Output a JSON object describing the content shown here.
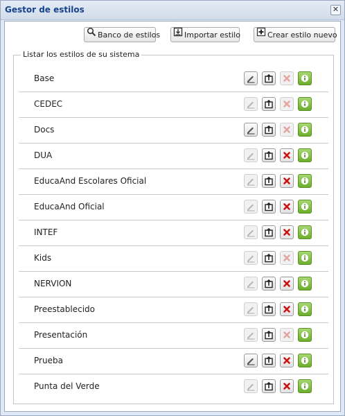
{
  "window": {
    "title": "Gestor de estilos",
    "close_label": "✕"
  },
  "toolbar": {
    "bank_label": "Banco de estilos",
    "import_label": "Importar estilo",
    "create_label": "Crear estilo nuevo"
  },
  "list": {
    "legend": "Listar los estilos de su sistema",
    "rows": [
      {
        "name": "Base",
        "edit_enabled": true,
        "delete_enabled": false
      },
      {
        "name": "CEDEC",
        "edit_enabled": false,
        "delete_enabled": false
      },
      {
        "name": "Docs",
        "edit_enabled": true,
        "delete_enabled": false
      },
      {
        "name": "DUA",
        "edit_enabled": false,
        "delete_enabled": true
      },
      {
        "name": "EducaAnd Escolares Oficial",
        "edit_enabled": false,
        "delete_enabled": true
      },
      {
        "name": "EducaAnd Oficial",
        "edit_enabled": false,
        "delete_enabled": true
      },
      {
        "name": "INTEF",
        "edit_enabled": false,
        "delete_enabled": true
      },
      {
        "name": "Kids",
        "edit_enabled": false,
        "delete_enabled": false
      },
      {
        "name": "NERVION",
        "edit_enabled": false,
        "delete_enabled": true
      },
      {
        "name": "Preestablecido",
        "edit_enabled": false,
        "delete_enabled": true
      },
      {
        "name": "Presentación",
        "edit_enabled": false,
        "delete_enabled": false
      },
      {
        "name": "Prueba",
        "edit_enabled": true,
        "delete_enabled": true
      },
      {
        "name": "Punta del Verde",
        "edit_enabled": false,
        "delete_enabled": true
      }
    ]
  },
  "icons": {
    "row_actions": [
      "edit-icon",
      "export-icon",
      "delete-icon",
      "info-icon"
    ],
    "toolbar": [
      "magnifier-icon",
      "import-icon",
      "plus-icon"
    ]
  },
  "colors": {
    "title_text": "#15428b",
    "window_bg": "#dfe8f6",
    "delete_red": "#cc1111",
    "info_green": "#6cae2b"
  }
}
